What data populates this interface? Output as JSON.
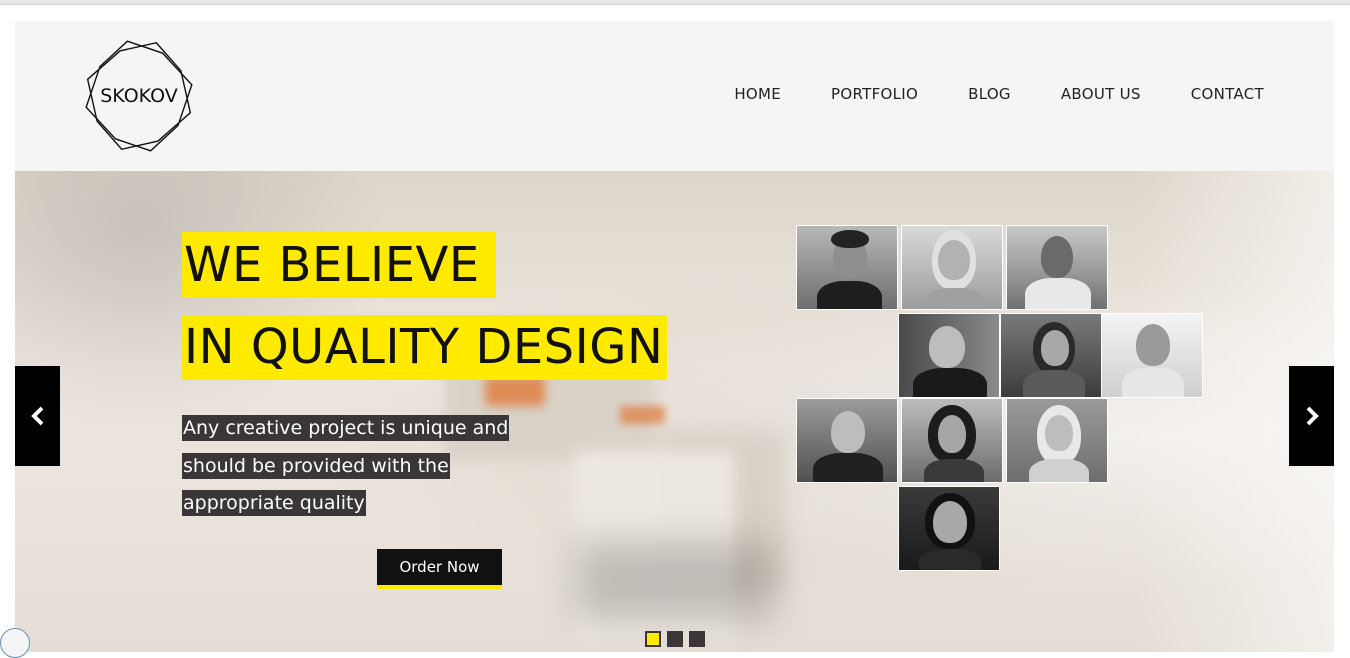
{
  "brand": {
    "logo_text": "SKOKOV"
  },
  "nav": {
    "items": [
      "HOME",
      "PORTFOLIO",
      "BLOG",
      "ABOUT US",
      "CONTACT"
    ]
  },
  "hero": {
    "headline_line1": "WE BELIEVE",
    "headline_line2": "IN QUALITY DESIGN",
    "sub_line1": "Any creative project is unique and",
    "sub_line2": "should be provided with the",
    "sub_line3": "appropriate quality",
    "cta_label": "Order Now",
    "prev_icon": "chevron-left-icon",
    "next_icon": "chevron-right-icon",
    "slides_total": 3,
    "active_slide": 1
  },
  "colors": {
    "accent": "#ffea00",
    "dark": "#3a3638",
    "black": "#000000"
  },
  "team_photos_count": 10
}
